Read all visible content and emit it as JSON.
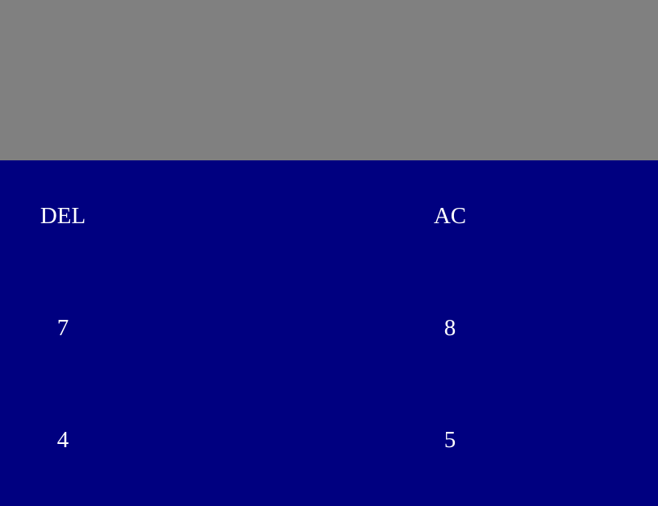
{
  "display": {
    "value": ""
  },
  "keypad": {
    "keys": [
      {
        "label": "DEL"
      },
      {
        "label": "AC"
      },
      {
        "label": "7"
      },
      {
        "label": "8"
      },
      {
        "label": "4"
      },
      {
        "label": "5"
      }
    ]
  },
  "colors": {
    "display_bg": "#808080",
    "keypad_bg": "#000080",
    "key_text": "#ffffff"
  }
}
